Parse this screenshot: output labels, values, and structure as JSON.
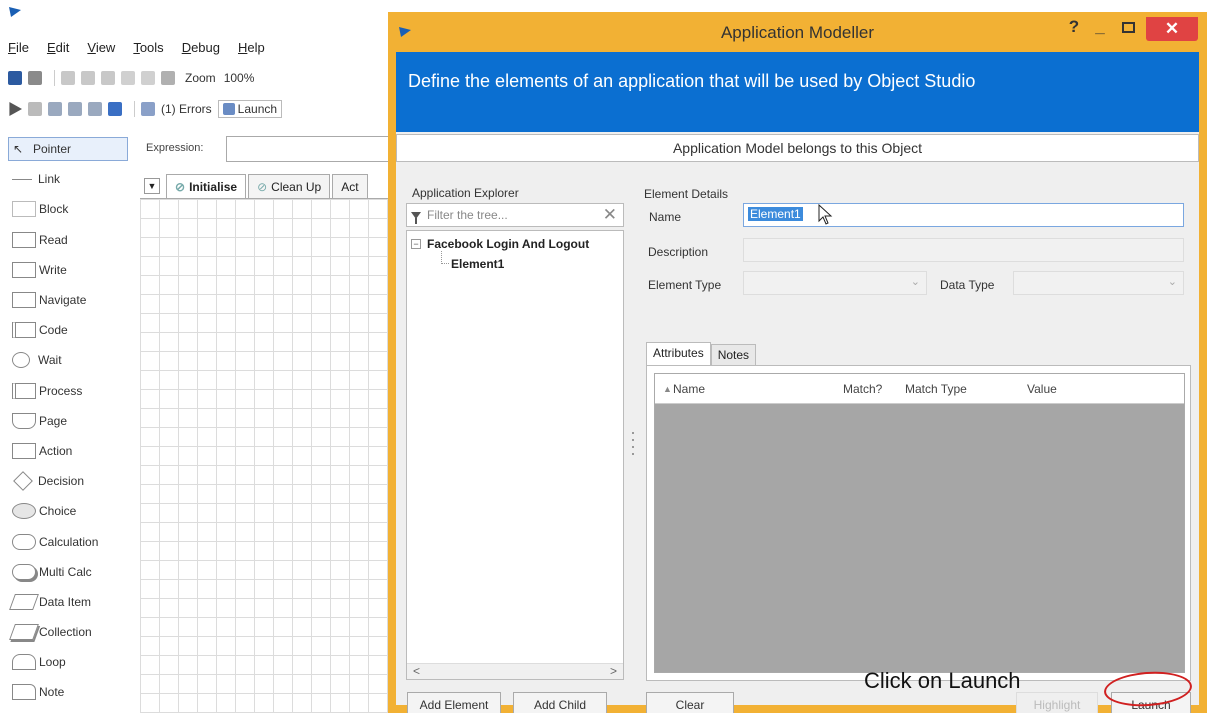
{
  "studio": {
    "menu": [
      "File",
      "Edit",
      "View",
      "Tools",
      "Debug",
      "Help"
    ],
    "zoom_label": "Zoom",
    "zoom_value": "100%",
    "errors_label": "(1) Errors",
    "launch_label": "Launch",
    "expression_label": "Expression:",
    "tools": [
      "Pointer",
      "Link",
      "Block",
      "Read",
      "Write",
      "Navigate",
      "Code",
      "Wait",
      "Process",
      "Page",
      "Action",
      "Decision",
      "Choice",
      "Calculation",
      "Multi Calc",
      "Data Item",
      "Collection",
      "Loop",
      "Note"
    ],
    "tabs": [
      "Initialise",
      "Clean Up",
      "Act"
    ]
  },
  "dialog": {
    "title": "Application Modeller",
    "help": "?",
    "banner_text": "Define the elements of an application that will be used by Object Studio",
    "subbar_text": "Application Model belongs to this Object",
    "explorer": {
      "label": "Application Explorer",
      "filter_placeholder": "Filter the tree...",
      "root": "Facebook Login And Logout",
      "child": "Element1"
    },
    "details": {
      "label": "Element Details",
      "name_label": "Name",
      "name_value": "Element1",
      "description_label": "Description",
      "element_type_label": "Element Type",
      "data_type_label": "Data Type",
      "tabs": [
        "Attributes",
        "Notes"
      ],
      "columns": [
        "Name",
        "Match?",
        "Match Type",
        "Value"
      ]
    },
    "buttons": {
      "add_element": "Add Element",
      "add_child": "Add Child",
      "clear": "Clear",
      "highlight": "Highlight",
      "launch": "Launch"
    }
  },
  "overlay": {
    "caption": "Click on Launch"
  },
  "colors": {
    "dialog_frame": "#f2b134",
    "banner": "#0b6fd1",
    "close_button": "#e04343",
    "annotation_circle": "#d02020"
  }
}
